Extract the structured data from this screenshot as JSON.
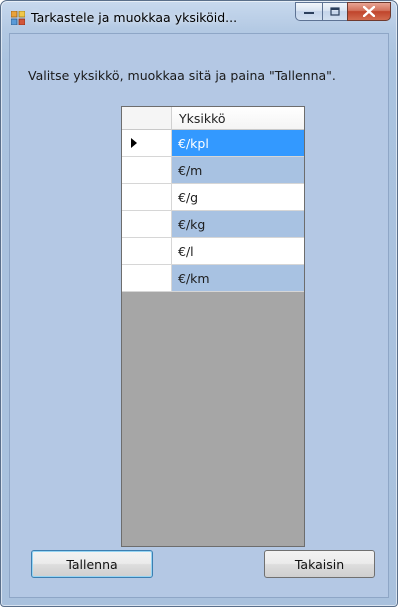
{
  "window": {
    "title": "Tarkastele ja muokkaa yksiköid...",
    "instruction": "Valitse yksikkö, muokkaa sitä ja paina \"Tallenna\"."
  },
  "grid": {
    "column_header": "Yksikkö",
    "rows": [
      {
        "value": "€/kpl",
        "current": true,
        "selected": true
      },
      {
        "value": "€/m"
      },
      {
        "value": "€/g"
      },
      {
        "value": "€/kg"
      },
      {
        "value": "€/l"
      },
      {
        "value": "€/km"
      }
    ]
  },
  "buttons": {
    "save_label": "Tallenna",
    "back_label": "Takaisin"
  },
  "colors": {
    "selection": "#3399ff",
    "alt_row": "#a8c2e2",
    "grid_background": "#a6a6a6",
    "client_background": "#b4c8e4"
  }
}
